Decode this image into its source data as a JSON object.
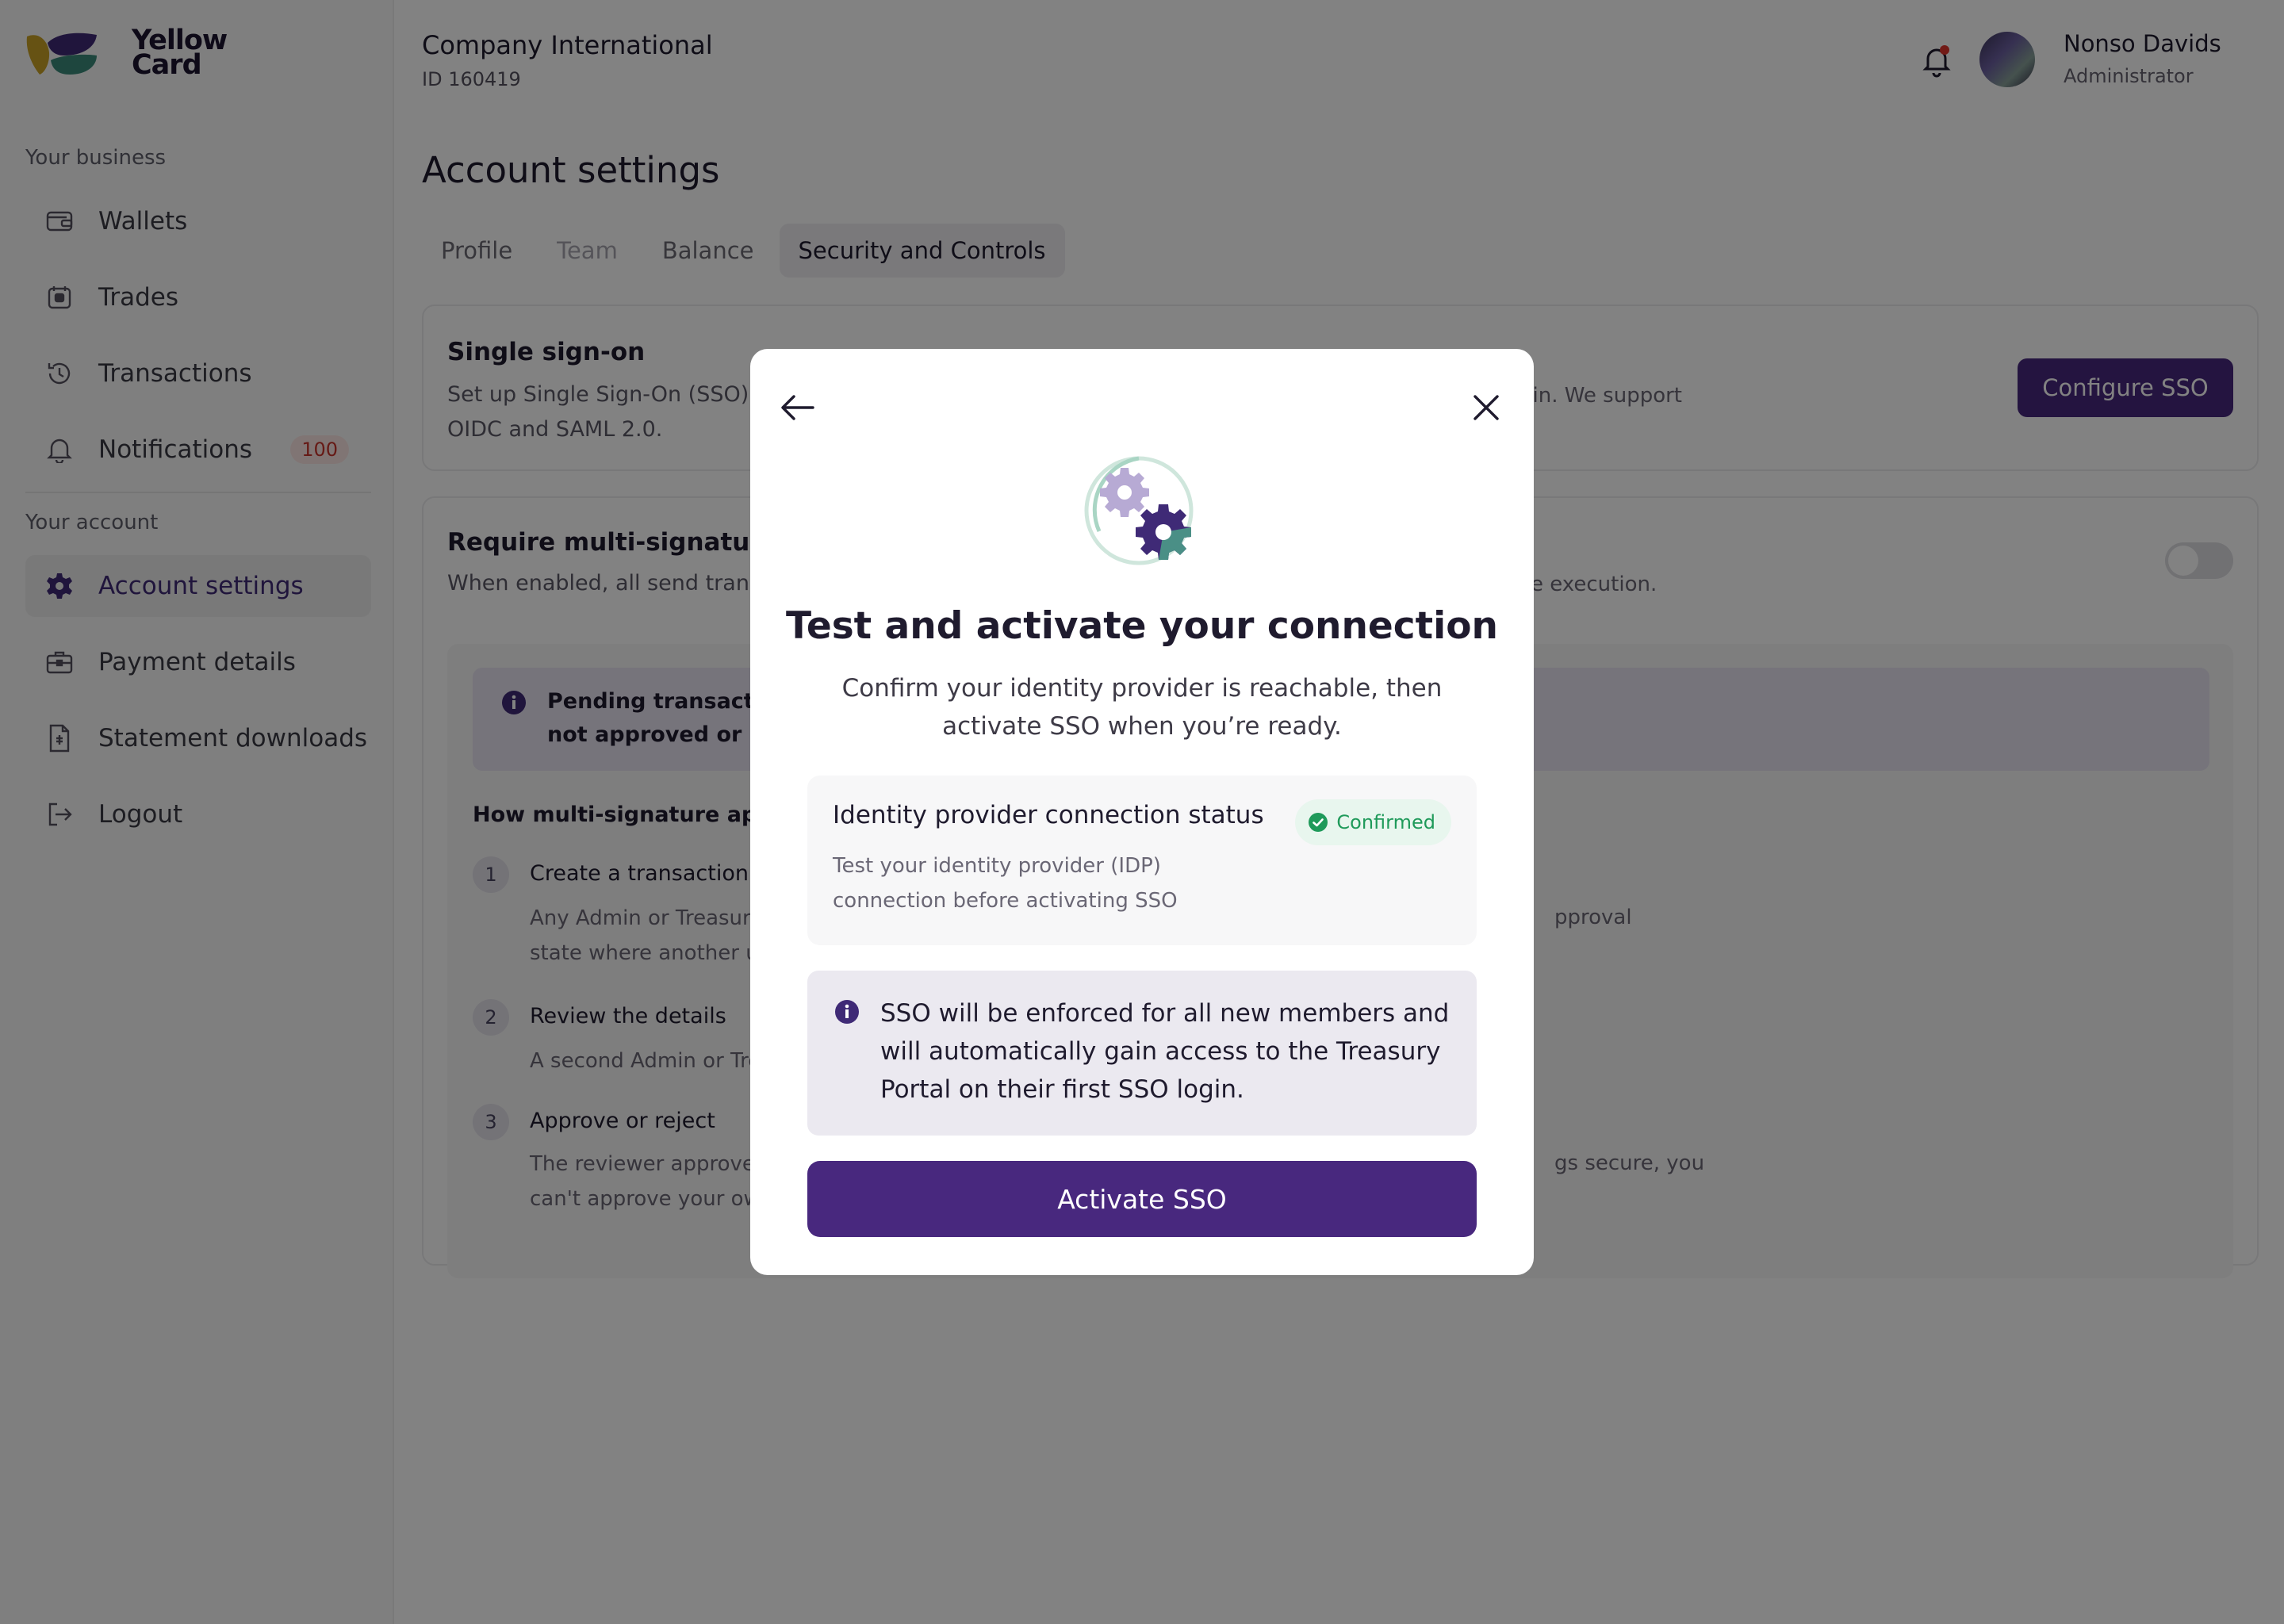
{
  "brand": {
    "logo_text_line1": "Yellow",
    "logo_text_line2": "Card",
    "accent": "#48287e",
    "logo_colors": [
      "#c9a227",
      "#3f2a76",
      "#3b8a7a"
    ]
  },
  "sidebar": {
    "business_label": "Your business",
    "account_label": "Your account",
    "items": [
      {
        "label": "Wallets",
        "icon": "wallet-icon"
      },
      {
        "label": "Trades",
        "icon": "trades-icon"
      },
      {
        "label": "Transactions",
        "icon": "history-icon"
      },
      {
        "label": "Notifications",
        "icon": "bell-icon",
        "badge": "100"
      },
      {
        "label": "Account settings",
        "icon": "gear-icon",
        "active": true
      },
      {
        "label": "Payment details",
        "icon": "briefcase-icon"
      },
      {
        "label": "Statement downloads",
        "icon": "document-icon"
      },
      {
        "label": "Logout",
        "icon": "logout-icon"
      }
    ]
  },
  "header": {
    "company": "Company International",
    "company_id": "ID 160419",
    "user_name": "Nonso Davids",
    "user_role": "Administrator"
  },
  "main": {
    "title": "Account settings",
    "tabs": [
      {
        "label": "Profile"
      },
      {
        "label": "Team"
      },
      {
        "label": "Balance"
      },
      {
        "label": "Security and Controls",
        "active": true
      }
    ],
    "sso_card": {
      "title": "Single sign-on",
      "desc_line1": "Set up Single Sign-On (SSO) so",
      "desc_line1_tail": "gin. We support",
      "desc_line2": "OIDC and SAML 2.0.",
      "button": "Configure SSO"
    },
    "multisig_card": {
      "title": "Require multi-signature app",
      "desc": "When enabled, all send transact",
      "desc_tail": "e execution.",
      "pending_line1": "Pending transactions",
      "pending_line2": "not approved or reje",
      "how_title": "How multi-signature approva",
      "steps": [
        {
          "num": "1",
          "title": "Create a transaction",
          "desc_line1": "Any Admin or Treasury",
          "desc_line2": "state where another use",
          "desc_tail": "pproval"
        },
        {
          "num": "2",
          "title": "Review the details",
          "desc_line1": "A second Admin or Trea"
        },
        {
          "num": "3",
          "title": "Approve or reject",
          "desc_line1": "The reviewer approves t",
          "desc_line2": "can't approve your own",
          "desc_tail": "gs secure, you"
        }
      ]
    }
  },
  "modal": {
    "title": "Test and activate your connection",
    "subtitle": "Confirm your identity provider is reachable, then activate SSO when you’re ready.",
    "status_title": "Identity provider connection status",
    "status_desc": "Test your identity provider (IDP) connection before activating SSO",
    "status_badge": "Confirmed",
    "notice": "SSO will be enforced for all new members and will automatically gain access to the Treasury Portal on their first SSO login.",
    "button": "Activate SSO"
  }
}
